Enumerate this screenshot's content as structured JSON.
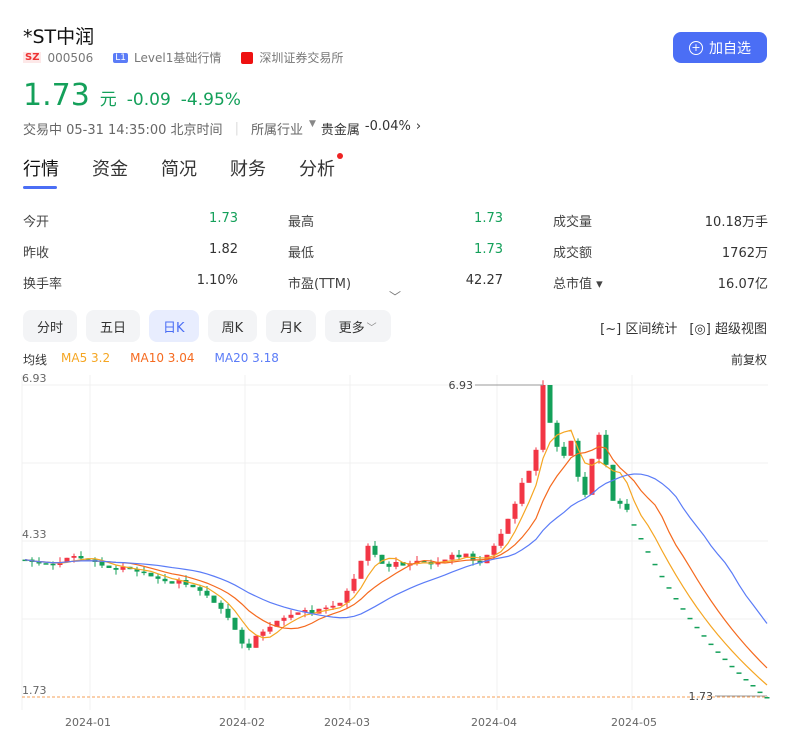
{
  "header": {
    "name": "*ST中润",
    "exchange_badge": "SZ",
    "code": "000506",
    "level_badge": "L1",
    "level_text": "Level1基础行情",
    "exchange_name": "深圳证券交易所",
    "add_watch": "加自选"
  },
  "quote": {
    "price": "1.73",
    "unit": "元",
    "change": "-0.09",
    "change_pct": "-4.95%",
    "status": "交易中 05-31 14:35:00 北京时间",
    "industry_label": "所属行业",
    "industry": "贵金属",
    "industry_change": "-0.04%"
  },
  "tabs": [
    "行情",
    "资金",
    "简况",
    "财务",
    "分析"
  ],
  "stats": [
    [
      {
        "l": "今开",
        "v": "1.73",
        "c": "g"
      },
      {
        "l": "最高",
        "v": "1.73",
        "c": "g"
      },
      {
        "l": "成交量",
        "v": "10.18万手",
        "c": "v"
      }
    ],
    [
      {
        "l": "昨收",
        "v": "1.82",
        "c": "v"
      },
      {
        "l": "最低",
        "v": "1.73",
        "c": "g"
      },
      {
        "l": "成交额",
        "v": "1762万",
        "c": "v"
      }
    ],
    [
      {
        "l": "换手率",
        "v": "1.10%",
        "c": "v"
      },
      {
        "l": "市盈(TTM)",
        "v": "42.27",
        "c": "v"
      },
      {
        "l": "总市值 ▾",
        "v": "16.07亿",
        "c": "v"
      }
    ]
  ],
  "periods": [
    "分时",
    "五日",
    "日K",
    "周K",
    "月K",
    "更多"
  ],
  "tools": {
    "range": "区间统计",
    "super": "超级视图"
  },
  "ma": {
    "label": "均线",
    "ma5": "MA5 3.2",
    "ma10": "MA10 3.04",
    "ma20": "MA20 3.18",
    "adjust": "前复权"
  },
  "colors": {
    "up": "#f23645",
    "down": "#14a05a",
    "ma5": "#f5a623",
    "ma10": "#f56a1f",
    "ma20": "#5b7cf7",
    "accent": "#4b6ef5"
  },
  "chart_data": {
    "type": "candlestick",
    "ylim": [
      1.73,
      6.93
    ],
    "yticks": [
      "6.93",
      "4.33",
      "1.73"
    ],
    "xticks": [
      {
        "label": "2024-01",
        "index": 9
      },
      {
        "label": "2024-02",
        "index": 31
      },
      {
        "label": "2024-03",
        "index": 46
      },
      {
        "label": "2024-04",
        "index": 67
      },
      {
        "label": "2024-05",
        "index": 87
      }
    ],
    "max_label": "6.93",
    "last_label": "1.73",
    "limit_down_from": 87,
    "closes": [
      4.02,
      3.98,
      3.96,
      3.95,
      3.93,
      3.98,
      4.05,
      4.08,
      4.04,
      4.02,
      3.98,
      3.92,
      3.88,
      3.85,
      3.9,
      3.86,
      3.82,
      3.8,
      3.74,
      3.7,
      3.66,
      3.62,
      3.68,
      3.6,
      3.56,
      3.5,
      3.42,
      3.3,
      3.2,
      3.05,
      2.85,
      2.62,
      2.55,
      2.75,
      2.82,
      2.9,
      3.0,
      3.05,
      3.1,
      3.14,
      3.18,
      3.12,
      3.2,
      3.22,
      3.25,
      3.3,
      3.5,
      3.7,
      4.0,
      4.25,
      4.1,
      3.95,
      3.9,
      3.98,
      3.92,
      3.96,
      4.0,
      3.98,
      3.94,
      3.98,
      4.02,
      4.1,
      4.06,
      4.12,
      4.0,
      3.96,
      4.1,
      4.25,
      4.45,
      4.7,
      4.95,
      5.3,
      5.5,
      5.85,
      6.93,
      6.3,
      5.9,
      5.75,
      6.0,
      5.4,
      5.1,
      5.7,
      6.1,
      5.6,
      5.0,
      4.95,
      4.85,
      4.61,
      4.38,
      4.16,
      3.95,
      3.75,
      3.56,
      3.38,
      3.21,
      3.05,
      2.9,
      2.76,
      2.62,
      2.49,
      2.37,
      2.25,
      2.14,
      2.03,
      1.93,
      1.82,
      1.73
    ]
  }
}
